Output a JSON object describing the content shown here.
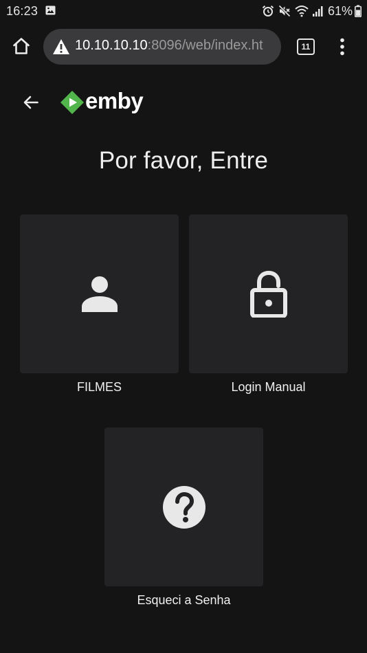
{
  "status_bar": {
    "time": "16:23",
    "battery": "61%",
    "icons": [
      "gallery-icon",
      "alarm-icon",
      "mute-icon",
      "wifi-icon",
      "signal-icon",
      "battery-icon"
    ]
  },
  "browser": {
    "url_host": "10.10.10.10",
    "url_rest": ":8096/web/index.ht",
    "tab_count": "11",
    "icons": [
      "home-icon",
      "warning-icon",
      "menu-icon"
    ]
  },
  "app": {
    "logo_text": "emby",
    "brand_color": "#52b54b"
  },
  "page": {
    "title": "Por favor, Entre"
  },
  "cards": {
    "user": {
      "label": "FILMES",
      "icon": "user-icon"
    },
    "manual": {
      "label": "Login Manual",
      "icon": "lock-open-icon"
    },
    "forgot": {
      "label": "Esqueci a Senha",
      "icon": "help-circle-icon"
    }
  },
  "colors": {
    "background": "#141414",
    "card": "#232325",
    "url_bar": "#3a3a3c",
    "text": "#eeeeee"
  }
}
